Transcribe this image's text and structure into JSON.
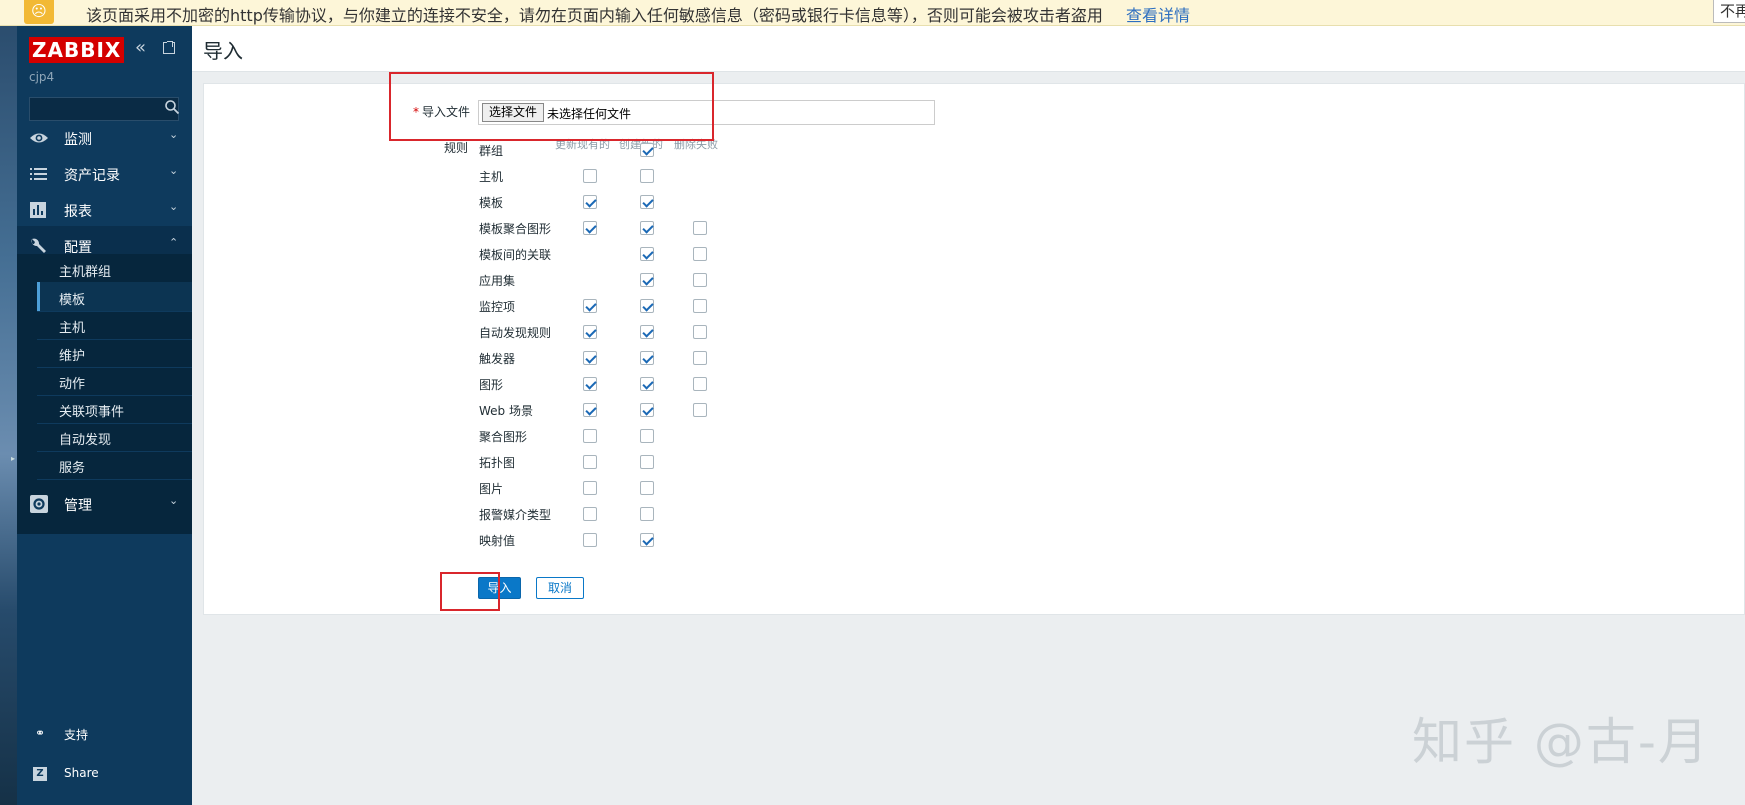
{
  "warning_bar": {
    "text": "该页面采用不加密的http传输协议，与你建立的连接不安全，请勿在页面内输入任何敏感信息（密码或银行卡信息等），否则可能会被攻击者盗用",
    "link": "查看详情",
    "button": "不再"
  },
  "sidebar": {
    "logo": "ZABBIX",
    "server_name": "cjp4",
    "search": {
      "value": "",
      "placeholder": ""
    },
    "menu": [
      {
        "label": "监测",
        "icon": "eye-icon"
      },
      {
        "label": "资产记录",
        "icon": "list-icon"
      },
      {
        "label": "报表",
        "icon": "bar-chart-icon"
      },
      {
        "label": "配置",
        "icon": "wrench-icon"
      },
      {
        "label": "管理",
        "icon": "gear-icon"
      }
    ],
    "submenu": [
      "主机群组",
      "模板",
      "主机",
      "维护",
      "动作",
      "关联项事件",
      "自动发现",
      "服务"
    ],
    "selected_submenu": "模板",
    "footer": [
      {
        "label": "支持",
        "icon": "headset-icon"
      },
      {
        "label": "Share",
        "icon": "share-z-icon"
      }
    ]
  },
  "header": {
    "title": "导入"
  },
  "form": {
    "file_label": "导入文件",
    "file_button": "选择文件",
    "file_status": "未选择任何文件",
    "rules_label": "规则",
    "columns": [
      "更新现有的",
      "创建新的",
      "删除失败"
    ],
    "rules": [
      {
        "name": "群组",
        "update": null,
        "create": true,
        "delete": null
      },
      {
        "name": "主机",
        "update": false,
        "create": false,
        "delete": null
      },
      {
        "name": "模板",
        "update": true,
        "create": true,
        "delete": null
      },
      {
        "name": "模板聚合图形",
        "update": true,
        "create": true,
        "delete": false
      },
      {
        "name": "模板间的关联",
        "update": null,
        "create": true,
        "delete": false
      },
      {
        "name": "应用集",
        "update": null,
        "create": true,
        "delete": false
      },
      {
        "name": "监控项",
        "update": true,
        "create": true,
        "delete": false
      },
      {
        "name": "自动发现规则",
        "update": true,
        "create": true,
        "delete": false
      },
      {
        "name": "触发器",
        "update": true,
        "create": true,
        "delete": false
      },
      {
        "name": "图形",
        "update": true,
        "create": true,
        "delete": false
      },
      {
        "name": "Web 场景",
        "update": true,
        "create": true,
        "delete": false
      },
      {
        "name": "聚合图形",
        "update": false,
        "create": false,
        "delete": null
      },
      {
        "name": "拓扑图",
        "update": false,
        "create": false,
        "delete": null
      },
      {
        "name": "图片",
        "update": false,
        "create": false,
        "delete": null
      },
      {
        "name": "报警媒介类型",
        "update": false,
        "create": false,
        "delete": null
      },
      {
        "name": "映射值",
        "update": false,
        "create": true,
        "delete": null
      }
    ],
    "import_button": "导入",
    "cancel_button": "取消"
  },
  "watermark": "知乎 @古-月",
  "colors": {
    "sidebar": "#0e3a5d",
    "logo": "#d40000",
    "primary": "#0a78c8",
    "highlight_box": "#d9262c"
  }
}
